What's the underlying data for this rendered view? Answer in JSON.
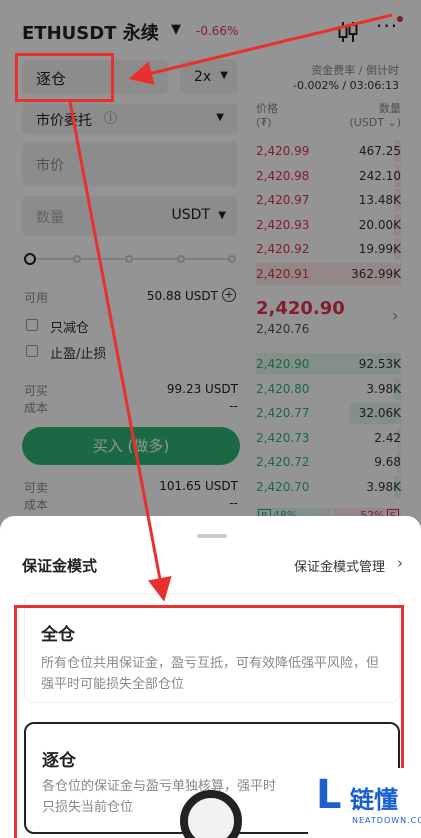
{
  "header": {
    "pair": "ETHUSDT 永续",
    "change": "-0.66%"
  },
  "form": {
    "margin_mode": "逐仓",
    "leverage": "2x",
    "order_type": "市价委托",
    "price_placeholder": "市价",
    "qty_placeholder": "数量",
    "qty_unit": "USDT",
    "available_label": "可用",
    "available_value": "50.88 USDT",
    "reduce_only": "只减仓",
    "tp_sl": "止盈/止损",
    "can_buy_label": "可买",
    "can_buy_value": "99.23 USDT",
    "cost_label": "成本",
    "cost_value": "--",
    "buy_button": "买入 (做多)",
    "can_sell_label": "可卖",
    "can_sell_value": "101.65 USDT",
    "cost2_label": "成本",
    "cost2_value": "--"
  },
  "funding": {
    "label": "资金费率 / 倒计时",
    "value": "-0.002% / 03:06:13"
  },
  "orderbook": {
    "price_header": "价格",
    "price_unit": "(₮)",
    "qty_header": "数量",
    "qty_unit": "(USDT ⌄)",
    "asks": [
      {
        "price": "2,420.99",
        "qty": "467.25",
        "depth": 0.05
      },
      {
        "price": "2,420.98",
        "qty": "242.10",
        "depth": 0.04
      },
      {
        "price": "2,420.97",
        "qty": "13.48K",
        "depth": 0.05
      },
      {
        "price": "2,420.93",
        "qty": "20.00K",
        "depth": 0.05
      },
      {
        "price": "2,420.92",
        "qty": "19.99K",
        "depth": 0.05
      },
      {
        "price": "2,420.91",
        "qty": "362.99K",
        "depth": 1.0
      }
    ],
    "last_price": "2,420.90",
    "mark_price": "2,420.76",
    "bids": [
      {
        "price": "2,420.90",
        "qty": "92.53K",
        "depth": 1.0
      },
      {
        "price": "2,420.80",
        "qty": "3.98K",
        "depth": 0.05
      },
      {
        "price": "2,420.77",
        "qty": "32.06K",
        "depth": 0.35
      },
      {
        "price": "2,420.73",
        "qty": "2.42",
        "depth": 0.03
      },
      {
        "price": "2,420.72",
        "qty": "9.68",
        "depth": 0.03
      },
      {
        "price": "2,420.70",
        "qty": "3.98K",
        "depth": 0.05
      }
    ],
    "buy_tag": "B",
    "buy_ratio": "48%",
    "sell_ratio": "52%",
    "sell_tag": "S"
  },
  "sheet": {
    "title": "保证金模式",
    "manage_link": "保证金模式管理",
    "options": [
      {
        "title": "全仓",
        "desc": "所有仓位共用保证金，盈亏互抵，可有效降低强平风险，但强平时可能损失全部仓位"
      },
      {
        "title": "逐仓",
        "desc": "各仓位的保证金与盈亏单独核算，强平时只损失当前仓位"
      }
    ]
  },
  "watermark": {
    "letter": "L",
    "cn": "链懂",
    "en": "NEATDOWN.COM"
  },
  "colors": {
    "buy": "#2db673",
    "sell": "#e0344b",
    "annotation": "#e8312f"
  }
}
